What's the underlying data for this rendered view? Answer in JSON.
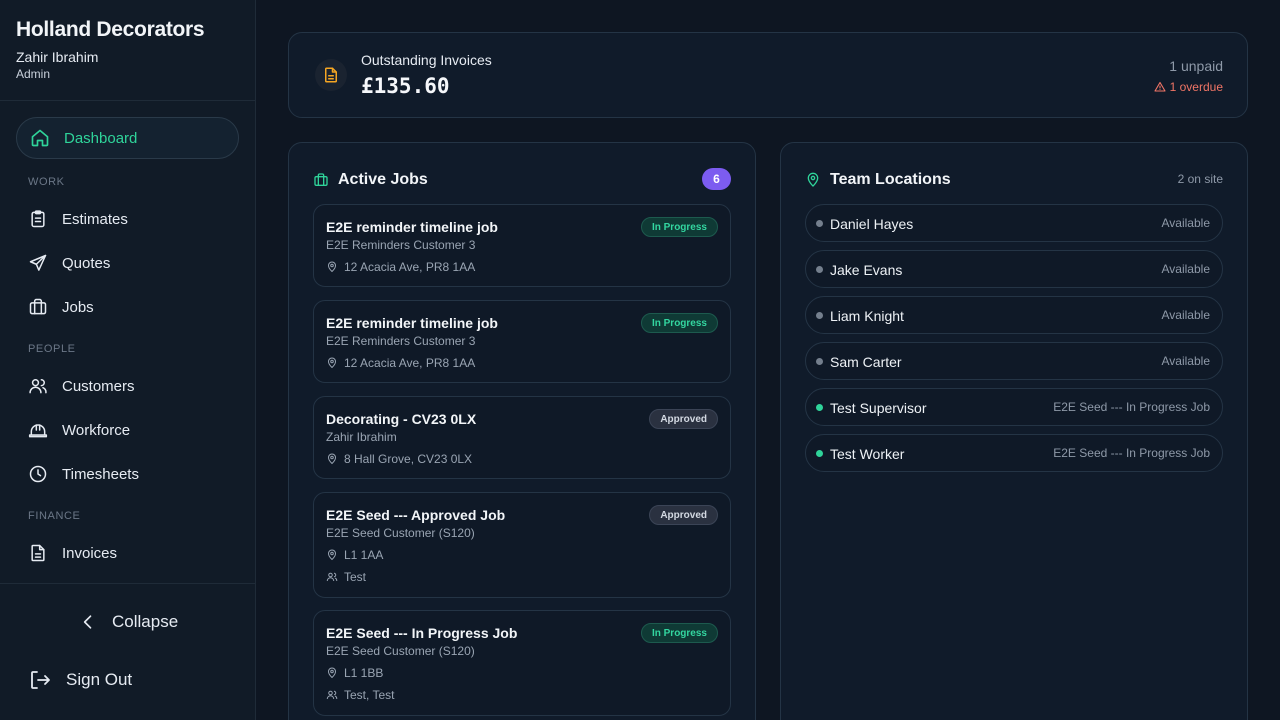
{
  "sidebar": {
    "brand": "Holland Decorators",
    "user_name": "Zahir Ibrahim",
    "user_role": "Admin",
    "active_item": "Dashboard",
    "sections": {
      "work": "WORK",
      "people": "PEOPLE",
      "finance": "FINANCE"
    },
    "items": {
      "estimates": "Estimates",
      "quotes": "Quotes",
      "jobs": "Jobs",
      "customers": "Customers",
      "workforce": "Workforce",
      "timesheets": "Timesheets",
      "invoices": "Invoices"
    },
    "collapse": "Collapse",
    "sign_out": "Sign Out"
  },
  "invoices": {
    "title": "Outstanding Invoices",
    "amount": "£135.60",
    "unpaid": "1 unpaid",
    "overdue": "1 overdue"
  },
  "jobs": {
    "title": "Active Jobs",
    "count": "6",
    "items": [
      {
        "title": "E2E reminder timeline job",
        "customer": "E2E Reminders Customer 3",
        "address": "12 Acacia Ave, PR8 1AA",
        "status": "In Progress"
      },
      {
        "title": "E2E reminder timeline job",
        "customer": "E2E Reminders Customer 3",
        "address": "12 Acacia Ave, PR8 1AA",
        "status": "In Progress"
      },
      {
        "title": "Decorating - CV23 0LX",
        "customer": "Zahir Ibrahim",
        "address": "8 Hall Grove, CV23 0LX",
        "status": "Approved"
      },
      {
        "title": "E2E Seed --- Approved Job",
        "customer": "E2E Seed Customer (S120)",
        "address": "L1 1AA",
        "team": "Test",
        "status": "Approved"
      },
      {
        "title": "E2E Seed --- In Progress Job",
        "customer": "E2E Seed Customer (S120)",
        "address": "L1 1BB",
        "team": "Test, Test",
        "status": "In Progress"
      }
    ]
  },
  "team": {
    "title": "Team Locations",
    "on_site": "2 on site",
    "members": [
      {
        "name": "Daniel Hayes",
        "status": "Available"
      },
      {
        "name": "Jake Evans",
        "status": "Available"
      },
      {
        "name": "Liam Knight",
        "status": "Available"
      },
      {
        "name": "Sam Carter",
        "status": "Available"
      },
      {
        "name": "Test Supervisor",
        "status": "E2E Seed --- In Progress Job"
      },
      {
        "name": "Test Worker",
        "status": "E2E Seed --- In Progress Job"
      }
    ]
  },
  "colors": {
    "accent": "#2fd49a",
    "overdue": "#f07566",
    "count_badge": "#7c5cf0",
    "invoice_icon": "#f5a623"
  }
}
